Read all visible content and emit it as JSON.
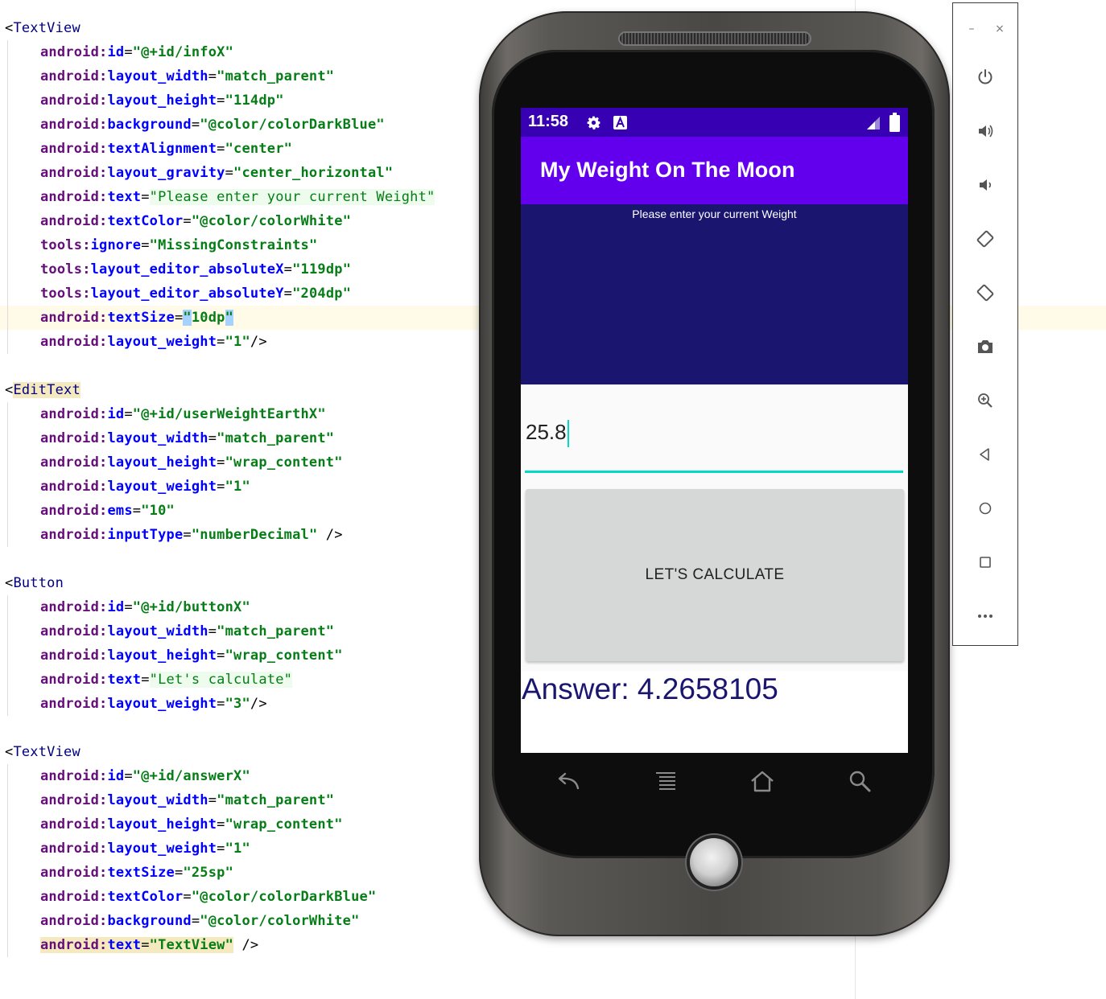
{
  "editor": {
    "blocks": [
      {
        "tag": "TextView",
        "attrs": [
          {
            "ns": "android",
            "name": "id",
            "value": "@+id/infoX"
          },
          {
            "ns": "android",
            "name": "layout_width",
            "value": "match_parent"
          },
          {
            "ns": "android",
            "name": "layout_height",
            "value": "114dp"
          },
          {
            "ns": "android",
            "name": "background",
            "value": "@color/colorDarkBlue"
          },
          {
            "ns": "android",
            "name": "textAlignment",
            "value": "center"
          },
          {
            "ns": "android",
            "name": "layout_gravity",
            "value": "center_horizontal"
          },
          {
            "ns": "android",
            "name": "text",
            "value": "Please enter your current Weight"
          },
          {
            "ns": "android",
            "name": "textColor",
            "value": "@color/colorWhite"
          },
          {
            "ns": "tools",
            "name": "ignore",
            "value": "MissingConstraints"
          },
          {
            "ns": "tools",
            "name": "layout_editor_absoluteX",
            "value": "119dp"
          },
          {
            "ns": "tools",
            "name": "layout_editor_absoluteY",
            "value": "204dp"
          },
          {
            "ns": "android",
            "name": "textSize",
            "value": "10dp"
          },
          {
            "ns": "android",
            "name": "layout_weight",
            "value": "1",
            "close": "/>"
          }
        ]
      },
      {
        "tag": "EditText",
        "attrs": [
          {
            "ns": "android",
            "name": "id",
            "value": "@+id/userWeightEarthX"
          },
          {
            "ns": "android",
            "name": "layout_width",
            "value": "match_parent"
          },
          {
            "ns": "android",
            "name": "layout_height",
            "value": "wrap_content"
          },
          {
            "ns": "android",
            "name": "layout_weight",
            "value": "1"
          },
          {
            "ns": "android",
            "name": "ems",
            "value": "10"
          },
          {
            "ns": "android",
            "name": "inputType",
            "value": "numberDecimal",
            "close": " />"
          }
        ]
      },
      {
        "tag": "Button",
        "attrs": [
          {
            "ns": "android",
            "name": "id",
            "value": "@+id/buttonX"
          },
          {
            "ns": "android",
            "name": "layout_width",
            "value": "match_parent"
          },
          {
            "ns": "android",
            "name": "layout_height",
            "value": "wrap_content"
          },
          {
            "ns": "android",
            "name": "text",
            "value": "Let's calculate"
          },
          {
            "ns": "android",
            "name": "layout_weight",
            "value": "3",
            "close": "/>"
          }
        ]
      },
      {
        "tag": "TextView",
        "attrs": [
          {
            "ns": "android",
            "name": "id",
            "value": "@+id/answerX"
          },
          {
            "ns": "android",
            "name": "layout_width",
            "value": "match_parent"
          },
          {
            "ns": "android",
            "name": "layout_height",
            "value": "wrap_content"
          },
          {
            "ns": "android",
            "name": "layout_weight",
            "value": "1"
          },
          {
            "ns": "android",
            "name": "textSize",
            "value": "25sp"
          },
          {
            "ns": "android",
            "name": "textColor",
            "value": "@color/colorDarkBlue"
          },
          {
            "ns": "android",
            "name": "background",
            "value": "@color/colorWhite"
          },
          {
            "ns": "android",
            "name": "text",
            "value": "TextView",
            "close": " />"
          }
        ]
      }
    ]
  },
  "phone": {
    "status_bar": {
      "time": "11:58",
      "icons": [
        "gear-icon",
        "a-badge-icon",
        "signal-icon",
        "battery-icon"
      ]
    },
    "app_title": "My Weight On The Moon",
    "info_text": "Please enter your current Weight",
    "weight_input": {
      "value": "25.8"
    },
    "calc_button_label": "LET'S CALCULATE",
    "answer_text": "Answer: 4.2658105",
    "hardware_keys": [
      "back-icon",
      "menu-icon",
      "home-icon",
      "search-icon"
    ]
  },
  "emulator_toolbar": {
    "window_controls": {
      "minimize": "–",
      "close": "×"
    },
    "buttons": [
      "power-icon",
      "volume-up-icon",
      "volume-down-icon",
      "rotate-left-icon",
      "rotate-right-icon",
      "camera-icon",
      "zoom-icon",
      "back-icon",
      "home-icon",
      "overview-icon",
      "more-icon"
    ]
  },
  "colors": {
    "status_bar": "#3700b3",
    "app_bar": "#6200ee",
    "dark_blue": "#1a1670",
    "accent": "#03dac5",
    "button": "#d6d7d7"
  }
}
